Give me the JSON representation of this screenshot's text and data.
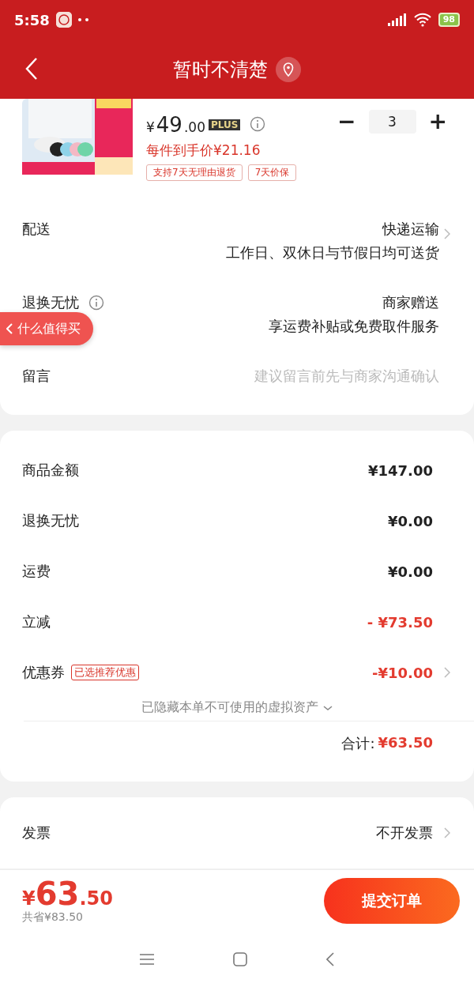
{
  "status_bar": {
    "time": "5:58",
    "battery": "98"
  },
  "header": {
    "title": "暂时不清楚"
  },
  "product": {
    "currency": "¥",
    "price_int": "49",
    "price_dec": ".00",
    "plus_badge": "PLUS",
    "unit_price": "每件到手价¥21.16",
    "tags": [
      "支持7天无理由退货",
      "7天价保"
    ],
    "minus": "−",
    "quantity": "3",
    "plus": "+"
  },
  "options": [
    {
      "label": "配送",
      "info": false,
      "chevron": true,
      "kind": "value",
      "lines": [
        "快递运输",
        "工作日、双休日与节假日均可送货"
      ]
    },
    {
      "label": "退换无忧",
      "info": true,
      "chevron": false,
      "kind": "value",
      "lines": [
        "商家赠送",
        "享运费补贴或免费取件服务"
      ]
    },
    {
      "label": "留言",
      "info": false,
      "chevron": false,
      "kind": "input",
      "placeholder": "建议留言前先与商家沟通确认"
    }
  ],
  "floating_tab": {
    "label": "什么值得买"
  },
  "summary": {
    "rows": [
      {
        "label": "商品金额",
        "value": "¥147.00",
        "kind": "normal",
        "chevron": false
      },
      {
        "label": "退换无忧",
        "value": "¥0.00",
        "kind": "normal",
        "chevron": false
      },
      {
        "label": "运费",
        "value": "¥0.00",
        "kind": "normal",
        "chevron": false
      },
      {
        "label": "立减",
        "value": "- ¥73.50",
        "kind": "discount",
        "chevron": false
      },
      {
        "label": "优惠券",
        "badge": "已选推荐优惠",
        "value": "-¥10.00",
        "kind": "discount",
        "chevron": true
      }
    ],
    "hidden_note": "已隐藏本单不可使用的虚拟资产",
    "total_label": "合计:",
    "total_value": "¥63.50"
  },
  "invoice": {
    "label": "发票",
    "value": "不开发票"
  },
  "checkout": {
    "currency": "¥",
    "price_int": "63",
    "price_dec": ".50",
    "saved": "共省¥83.50",
    "submit": "提交订单"
  }
}
